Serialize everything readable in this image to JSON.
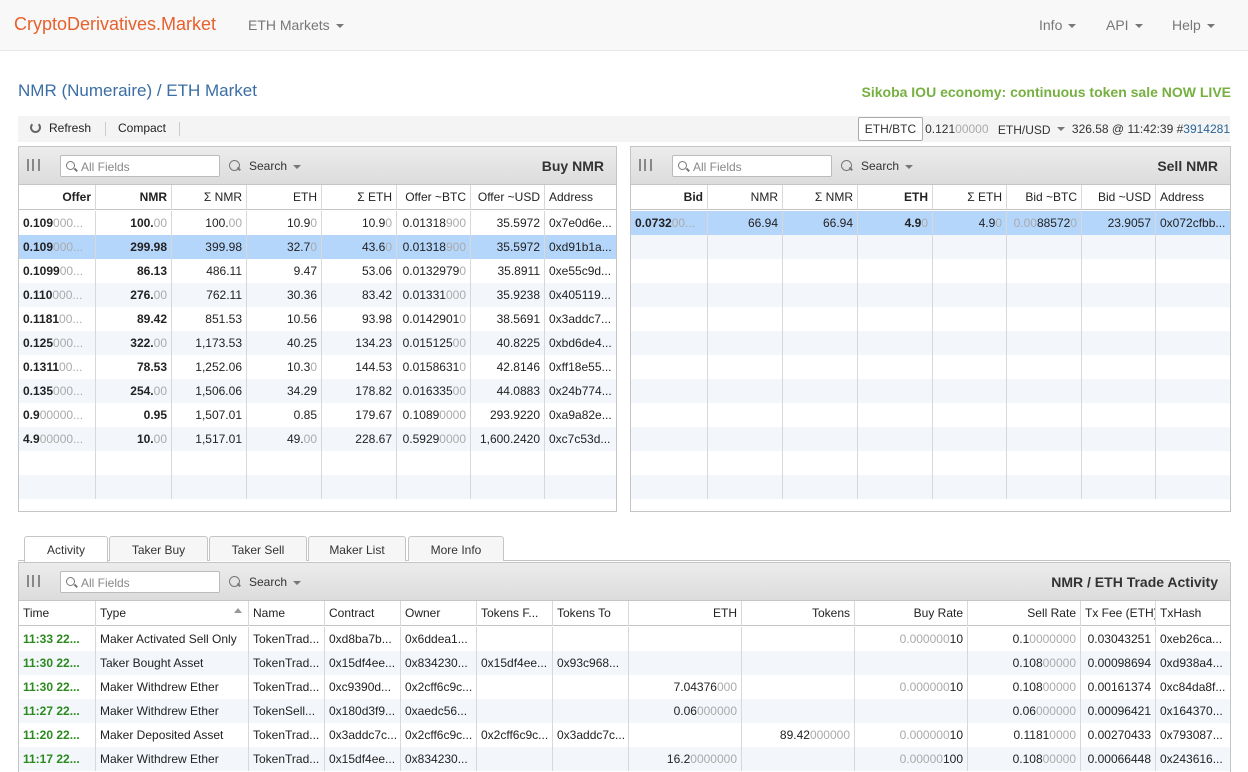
{
  "nav": {
    "brand": "CryptoDerivatives.Market",
    "markets": "ETH Markets",
    "info": "Info",
    "api": "API",
    "help": "Help"
  },
  "page": {
    "title": "NMR (Numeraire) / ETH Market",
    "promo": "Sikoba IOU economy: continuous token sale NOW LIVE"
  },
  "toolbar": {
    "refresh": "Refresh",
    "compact": "Compact",
    "pair": "ETH/BTC",
    "pair_value_main": "0.121",
    "pair_value_dim": "00000",
    "usd_label": "ETH/USD",
    "usd_value": "326.58 @ 11:42:39 #",
    "block": "3914281"
  },
  "buy_panel": {
    "title": "Buy NMR",
    "search_placeholder": "All Fields",
    "search_label": "Search",
    "columns": [
      "Offer",
      "NMR",
      "Σ NMR",
      "ETH",
      "Σ ETH",
      "Offer ~BTC",
      "Offer ~USD",
      "Address"
    ],
    "rows": [
      {
        "offer_main": "0.109",
        "offer_dim": "000...",
        "nmr_main": "100.",
        "nmr_dim": "00",
        "snmr_main": "100.",
        "snmr_dim": "00",
        "eth_main": "10.9",
        "eth_dim": "0",
        "seth_main": "10.9",
        "seth_dim": "0",
        "btc_main": "0.01318",
        "btc_dim": "900",
        "usd": "35.5972",
        "addr": "0x7e0d6e..."
      },
      {
        "offer_main": "0.109",
        "offer_dim": "000...",
        "nmr_main": "299.98",
        "nmr_dim": "",
        "snmr_main": "399.98",
        "snmr_dim": "",
        "eth_main": "32.7",
        "eth_dim": "0",
        "seth_main": "43.6",
        "seth_dim": "0",
        "btc_main": "0.01318",
        "btc_dim": "900",
        "usd": "35.5972",
        "addr": "0xd91b1a..."
      },
      {
        "offer_main": "0.1099",
        "offer_dim": "00...",
        "nmr_main": "86.13",
        "nmr_dim": "",
        "snmr_main": "486.11",
        "snmr_dim": "",
        "eth_main": "9.47",
        "eth_dim": "",
        "seth_main": "53.06",
        "seth_dim": "",
        "btc_main": "0.0132979",
        "btc_dim": "0",
        "usd": "35.8911",
        "addr": "0xe55c9d..."
      },
      {
        "offer_main": "0.110",
        "offer_dim": "000...",
        "nmr_main": "276.",
        "nmr_dim": "00",
        "snmr_main": "762.11",
        "snmr_dim": "",
        "eth_main": "30.36",
        "eth_dim": "",
        "seth_main": "83.42",
        "seth_dim": "",
        "btc_main": "0.01331",
        "btc_dim": "000",
        "usd": "35.9238",
        "addr": "0x405119..."
      },
      {
        "offer_main": "0.1181",
        "offer_dim": "00...",
        "nmr_main": "89.42",
        "nmr_dim": "",
        "snmr_main": "851.53",
        "snmr_dim": "",
        "eth_main": "10.56",
        "eth_dim": "",
        "seth_main": "93.98",
        "seth_dim": "",
        "btc_main": "0.0142901",
        "btc_dim": "0",
        "usd": "38.5691",
        "addr": "0x3addc7..."
      },
      {
        "offer_main": "0.125",
        "offer_dim": "000...",
        "nmr_main": "322.",
        "nmr_dim": "00",
        "snmr_main": "1,173.53",
        "snmr_dim": "",
        "eth_main": "40.25",
        "eth_dim": "",
        "seth_main": "134.23",
        "seth_dim": "",
        "btc_main": "0.015125",
        "btc_dim": "00",
        "usd": "40.8225",
        "addr": "0xbd6de4..."
      },
      {
        "offer_main": "0.1311",
        "offer_dim": "00...",
        "nmr_main": "78.53",
        "nmr_dim": "",
        "snmr_main": "1,252.06",
        "snmr_dim": "",
        "eth_main": "10.3",
        "eth_dim": "0",
        "seth_main": "144.53",
        "seth_dim": "",
        "btc_main": "0.0158631",
        "btc_dim": "0",
        "usd": "42.8146",
        "addr": "0xff18e55..."
      },
      {
        "offer_main": "0.135",
        "offer_dim": "000...",
        "nmr_main": "254.",
        "nmr_dim": "00",
        "snmr_main": "1,506.06",
        "snmr_dim": "",
        "eth_main": "34.29",
        "eth_dim": "",
        "seth_main": "178.82",
        "seth_dim": "",
        "btc_main": "0.016335",
        "btc_dim": "00",
        "usd": "44.0883",
        "addr": "0x24b774..."
      },
      {
        "offer_main": "0.9",
        "offer_dim": "00000...",
        "nmr_main": "0.95",
        "nmr_dim": "",
        "snmr_main": "1,507.01",
        "snmr_dim": "",
        "eth_main": "0.85",
        "eth_dim": "",
        "seth_main": "179.67",
        "seth_dim": "",
        "btc_main": "0.1089",
        "btc_dim": "0000",
        "usd": "293.9220",
        "addr": "0xa9a82e..."
      },
      {
        "offer_main": "4.9",
        "offer_dim": "00000...",
        "nmr_main": "10.",
        "nmr_dim": "00",
        "snmr_main": "1,517.01",
        "snmr_dim": "",
        "eth_main": "49.",
        "eth_dim": "00",
        "seth_main": "228.67",
        "seth_dim": "",
        "btc_main": "0.5929",
        "btc_dim": "0000",
        "usd": "1,600.2420",
        "addr": "0xc7c53d..."
      }
    ]
  },
  "sell_panel": {
    "title": "Sell NMR",
    "search_placeholder": "All Fields",
    "search_label": "Search",
    "columns": [
      "Bid",
      "NMR",
      "Σ NMR",
      "ETH",
      "Σ ETH",
      "Bid ~BTC",
      "Bid ~USD",
      "Address"
    ],
    "rows": [
      {
        "bid_main": "0.0732",
        "bid_dim": "00...",
        "nmr": "66.94",
        "snmr": "66.94",
        "eth_main": "4.9",
        "eth_dim": "0",
        "seth_main": "4.9",
        "seth_dim": "0",
        "btc_main": "0.00",
        "btc_mid": "88572",
        "btc_dim": "0",
        "usd": "23.9057",
        "addr": "0x072cfbb..."
      }
    ]
  },
  "tabs": [
    "Activity",
    "Taker Buy",
    "Taker Sell",
    "Maker List",
    "More Info"
  ],
  "activity_panel": {
    "title": "NMR / ETH Trade Activity",
    "search_placeholder": "All Fields",
    "search_label": "Search",
    "columns": [
      "Time",
      "Type",
      "Name",
      "Contract",
      "Owner",
      "Tokens F...",
      "Tokens To",
      "ETH",
      "Tokens",
      "Buy Rate",
      "Sell Rate",
      "Tx Fee (ETH)",
      "TxHash"
    ],
    "rows": [
      {
        "time": "11:33 22...",
        "type": "Maker Activated Sell Only",
        "name": "TokenTrad...",
        "contract": "0xd8ba7b...",
        "owner": "0x6ddea1...",
        "from": "",
        "to": "",
        "eth_main": "",
        "eth_dim": "",
        "tokens_main": "",
        "tokens_dim": "",
        "buy_main": "0.000000",
        "buy_end": "10",
        "sell_main": "0.1",
        "sell_dim": "0000000",
        "fee": "0.03043251",
        "hash": "0xeb26ca..."
      },
      {
        "time": "11:30 22...",
        "type": "Taker Bought Asset",
        "name": "TokenTrad...",
        "contract": "0x15df4ee...",
        "owner": "0x834230...",
        "from": "0x15df4ee...",
        "to": "0x93c968...",
        "eth_main": "",
        "eth_dim": "",
        "tokens_main": "",
        "tokens_dim": "",
        "buy_main": "",
        "buy_end": "",
        "sell_main": "0.108",
        "sell_dim": "00000",
        "fee": "0.00098694",
        "hash": "0xd938a4..."
      },
      {
        "time": "11:30 22...",
        "type": "Maker Withdrew Ether",
        "name": "TokenTrad...",
        "contract": "0xc9390d...",
        "owner": "0x2cff6c9c...",
        "from": "",
        "to": "",
        "eth_main": "7.04376",
        "eth_dim": "000",
        "tokens_main": "",
        "tokens_dim": "",
        "buy_main": "0.000000",
        "buy_end": "10",
        "sell_main": "0.108",
        "sell_dim": "00000",
        "fee": "0.00161374",
        "hash": "0xc84da8f..."
      },
      {
        "time": "11:27 22...",
        "type": "Maker Withdrew Ether",
        "name": "TokenSell...",
        "contract": "0x180d3f9...",
        "owner": "0xaedc56...",
        "from": "",
        "to": "",
        "eth_main": "0.06",
        "eth_dim": "000000",
        "tokens_main": "",
        "tokens_dim": "",
        "buy_main": "",
        "buy_end": "",
        "sell_main": "0.06",
        "sell_dim": "000000",
        "fee": "0.00096421",
        "hash": "0x164370..."
      },
      {
        "time": "11:20 22...",
        "type": "Maker Deposited Asset",
        "name": "TokenTrad...",
        "contract": "0x3addc7c...",
        "owner": "0x2cff6c9c...",
        "from": "0x2cff6c9c...",
        "to": "0x3addc7c...",
        "eth_main": "",
        "eth_dim": "",
        "tokens_main": "89.42",
        "tokens_dim": "000000",
        "buy_main": "0.000000",
        "buy_end": "10",
        "sell_main": "0.1181",
        "sell_dim": "0000",
        "fee": "0.00270433",
        "hash": "0x793087..."
      },
      {
        "time": "11:17 22...",
        "type": "Maker Withdrew Ether",
        "name": "TokenTrad...",
        "contract": "0x15df4ee...",
        "owner": "0x834230...",
        "from": "",
        "to": "",
        "eth_main": "16.2",
        "eth_dim": "0000000",
        "tokens_main": "",
        "tokens_dim": "",
        "buy_main": "0.00000",
        "buy_end": "100",
        "sell_main": "0.108",
        "sell_dim": "00000",
        "fee": "0.00066448",
        "hash": "0x243616..."
      }
    ]
  }
}
